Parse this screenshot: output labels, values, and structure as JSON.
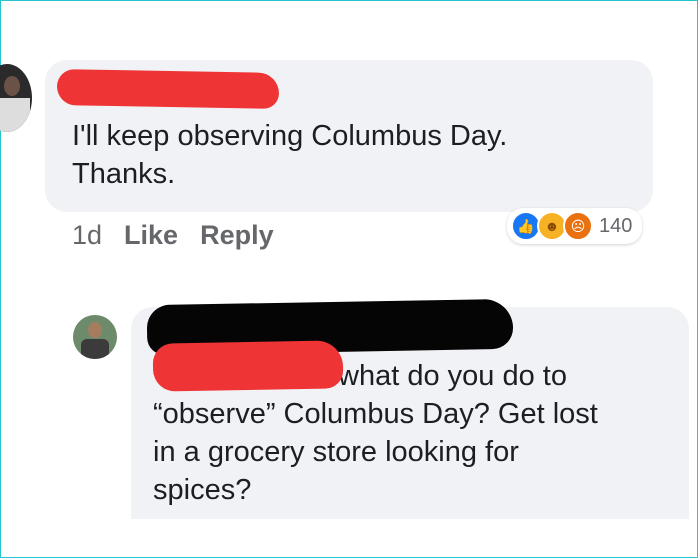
{
  "comment1": {
    "text": "I'll keep observing Columbus Day.\nThanks.",
    "time": "1d",
    "like_label": "Like",
    "reply_label": "Reply",
    "reactions": {
      "icons": [
        "like-icon",
        "haha-icon",
        "angry-icon"
      ],
      "count": "140"
    }
  },
  "comment2": {
    "text": "what do you do to\n“observe” Columbus Day? Get lost\nin a grocery store looking for\nspices?"
  },
  "colors": {
    "bubble": "#f0f2f5",
    "redaction_red": "#ee3434",
    "redaction_black": "#050505",
    "like_blue": "#1877f2",
    "meta_gray": "#65676b"
  }
}
